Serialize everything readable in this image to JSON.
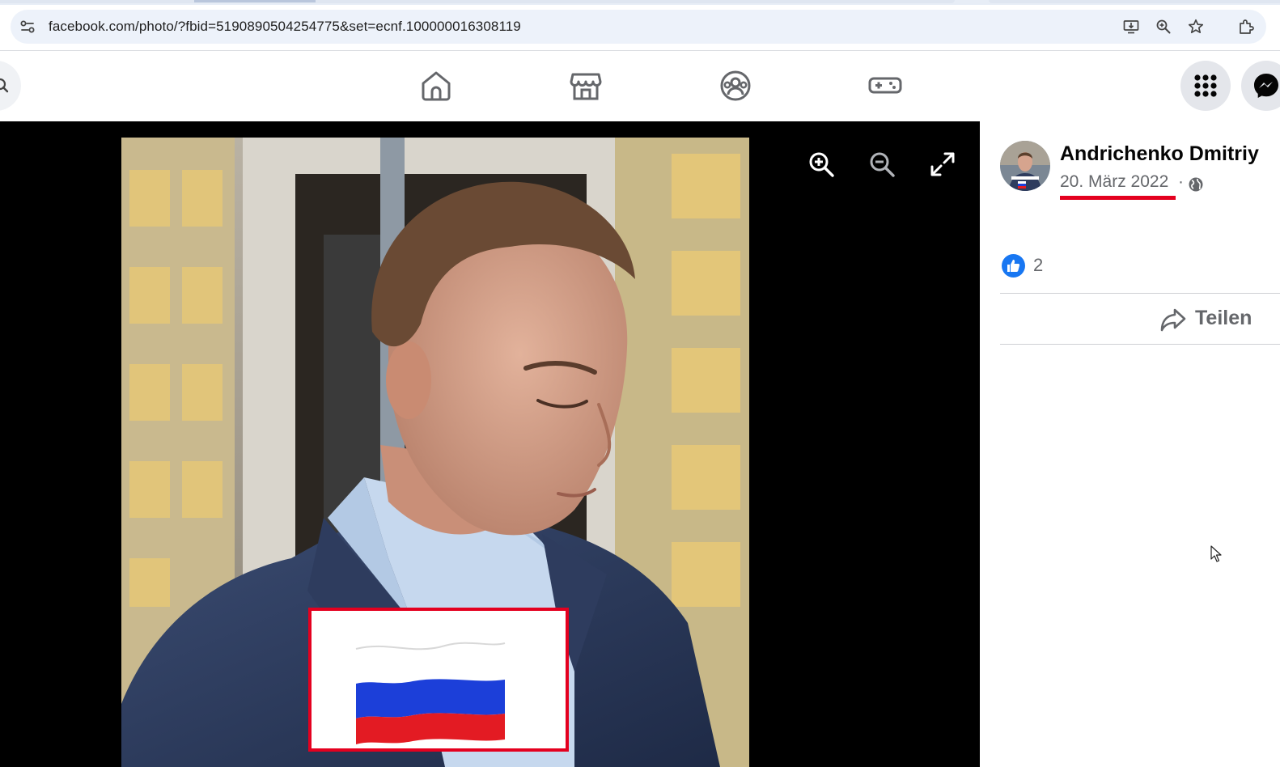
{
  "browser": {
    "url": "facebook.com/photo/?fbid=5190890504254775&set=ecnf.100000016308119",
    "icons": [
      "site-info-icon",
      "install-app-icon",
      "zoom-icon",
      "bookmark-star-icon",
      "extensions-icon"
    ]
  },
  "fb_nav": {
    "icons": [
      "search-icon",
      "home-icon",
      "marketplace-icon",
      "groups-icon",
      "gaming-icon",
      "menu-grid-icon",
      "messenger-icon"
    ]
  },
  "viewer": {
    "tools": [
      "zoom-in-icon",
      "zoom-out-icon",
      "fullscreen-icon"
    ],
    "annotation_color": "#e4001f"
  },
  "post": {
    "author": "Andrichenko Dmitriy",
    "date": "20. März 2022",
    "separator": "·",
    "privacy_icon": "globe-icon",
    "likes": "2",
    "share_label": "Teilen"
  },
  "colors": {
    "accent_blue": "#1877f2",
    "secondary_text": "#65676b",
    "annotation_red": "#e4001f"
  }
}
